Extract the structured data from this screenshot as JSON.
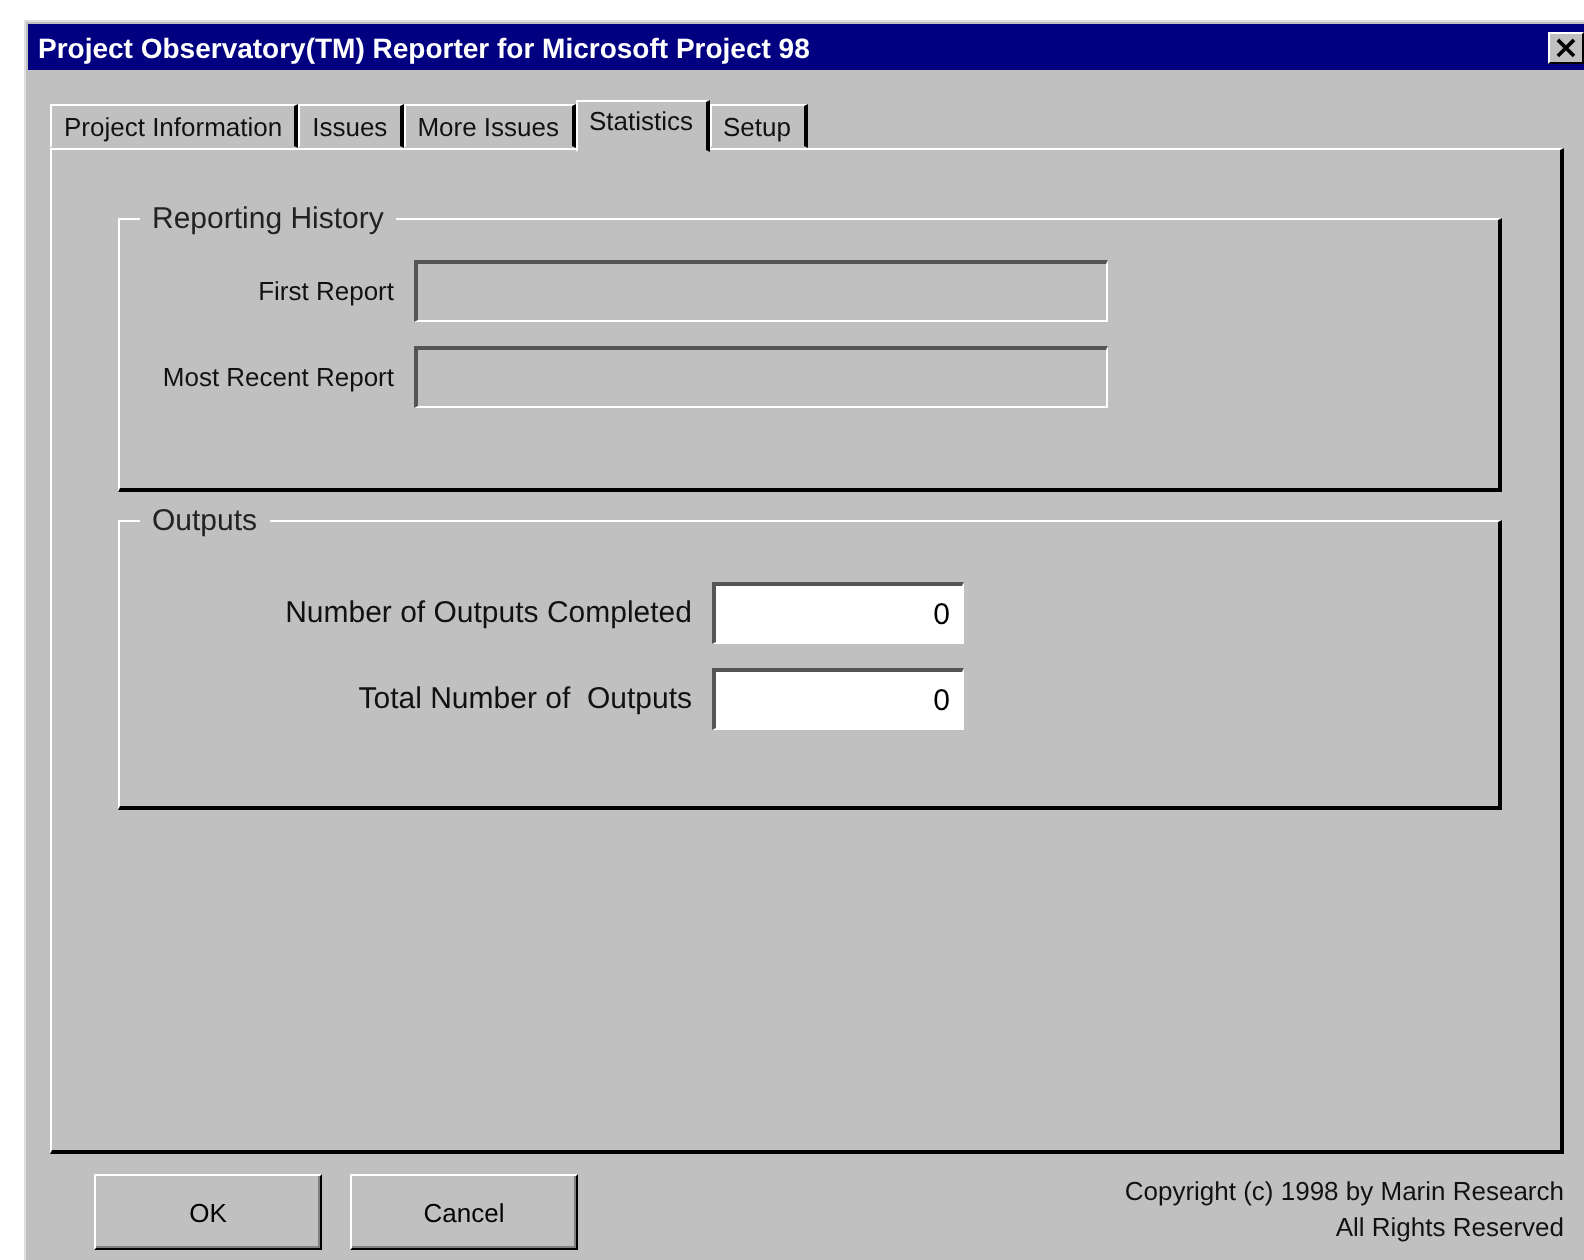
{
  "window": {
    "title": "Project Observatory(TM) Reporter for Microsoft Project 98",
    "close_button": "×"
  },
  "tabs": [
    {
      "label": "Project Information",
      "selected": false
    },
    {
      "label": "Issues",
      "selected": false
    },
    {
      "label": "More Issues",
      "selected": false
    },
    {
      "label": "Statistics",
      "selected": true
    },
    {
      "label": "Setup",
      "selected": false
    }
  ],
  "groups": [
    {
      "title": "Reporting History",
      "kind": "small",
      "fields": [
        {
          "label": "First Report",
          "disabled": true
        },
        {
          "label": "Most Recent Report",
          "disabled": true
        }
      ]
    },
    {
      "title": "Outputs",
      "kind": "large",
      "fields": [
        {
          "label": "Number of Outputs Completed",
          "value": "0",
          "disabled": false
        },
        {
          "label": "Total Number of  Outputs",
          "value": "0",
          "disabled": false
        }
      ]
    }
  ],
  "buttons": [
    "OK",
    "Cancel"
  ],
  "copyright": [
    "Copyright (c) 1998 by Marin Research",
    "All Rights Reserved"
  ]
}
